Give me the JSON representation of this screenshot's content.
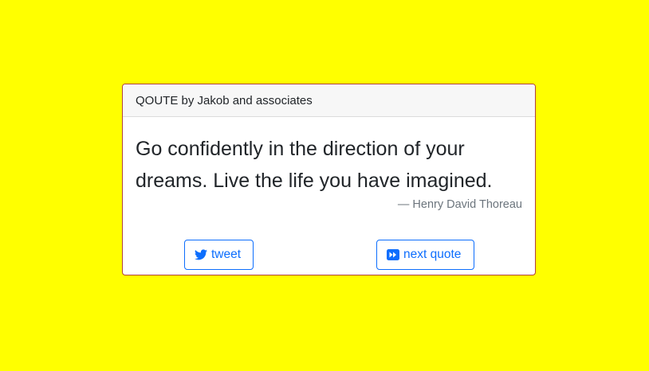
{
  "card": {
    "header": "QOUTE by Jakob and associates",
    "quote": "Go confidently in the direction of your dreams. Live the life you have imagined.",
    "author": "— Henry David Thoreau"
  },
  "actions": {
    "tweet_label": "tweet",
    "next_label": "next quote"
  },
  "colors": {
    "page_background": "#ffff00",
    "accent": "#0d6efd",
    "card_border": "#b0413e"
  }
}
